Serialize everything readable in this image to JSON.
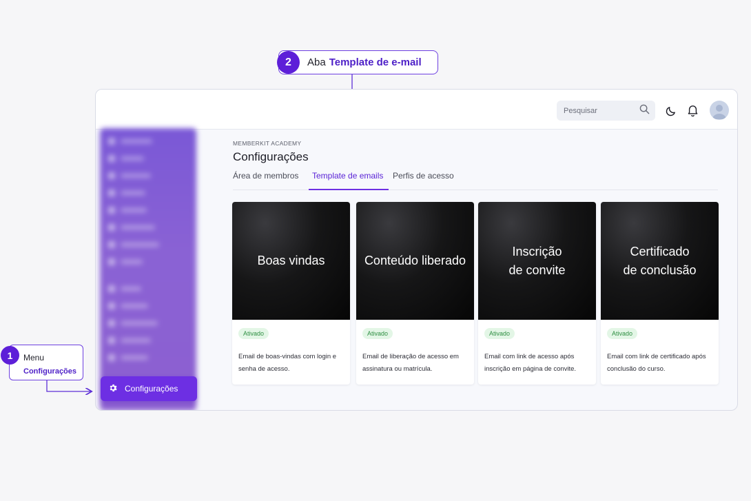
{
  "topbar": {
    "search_placeholder": "Pesquisar",
    "icons": [
      "search-icon",
      "moon-icon",
      "bell-icon",
      "avatar"
    ]
  },
  "sidebar": {
    "active_item": {
      "label": "Configurações",
      "icon": "gear-icon"
    }
  },
  "main": {
    "breadcrumb": "MEMBERKIT ACADEMY",
    "title": "Configurações",
    "tabs": [
      {
        "label": "Área de membros",
        "active": false
      },
      {
        "label": "Template de emails",
        "active": true
      },
      {
        "label": "Perfis de acesso",
        "active": false
      }
    ],
    "cards": [
      {
        "title_lines": [
          "Boas vindas"
        ],
        "badge": "Ativado",
        "description": "Email de boas-vindas com login e senha de acesso."
      },
      {
        "title_lines": [
          "Conteúdo liberado"
        ],
        "badge": "Ativado",
        "description": "Email de liberação de acesso em assinatura ou matrícula."
      },
      {
        "title_lines": [
          "Inscrição",
          "de convite"
        ],
        "badge": "Ativado",
        "description": "Email com link de acesso após inscrição em página de convite."
      },
      {
        "title_lines": [
          "Certificado",
          "de conclusão"
        ],
        "badge": "Ativado",
        "description": "Email com link de certificado após conclusão do curso."
      }
    ]
  },
  "callouts": {
    "step1": {
      "number": "1",
      "line1": "Menu",
      "line2": "Configurações"
    },
    "step2": {
      "number": "2",
      "prefix": "Aba",
      "highlight": "Template de e-mail"
    }
  },
  "colors": {
    "accent": "#6d2fe3",
    "accent_dark": "#4d1fc7",
    "badge_bg": "#e3f6e6",
    "badge_text": "#2f8f43"
  }
}
